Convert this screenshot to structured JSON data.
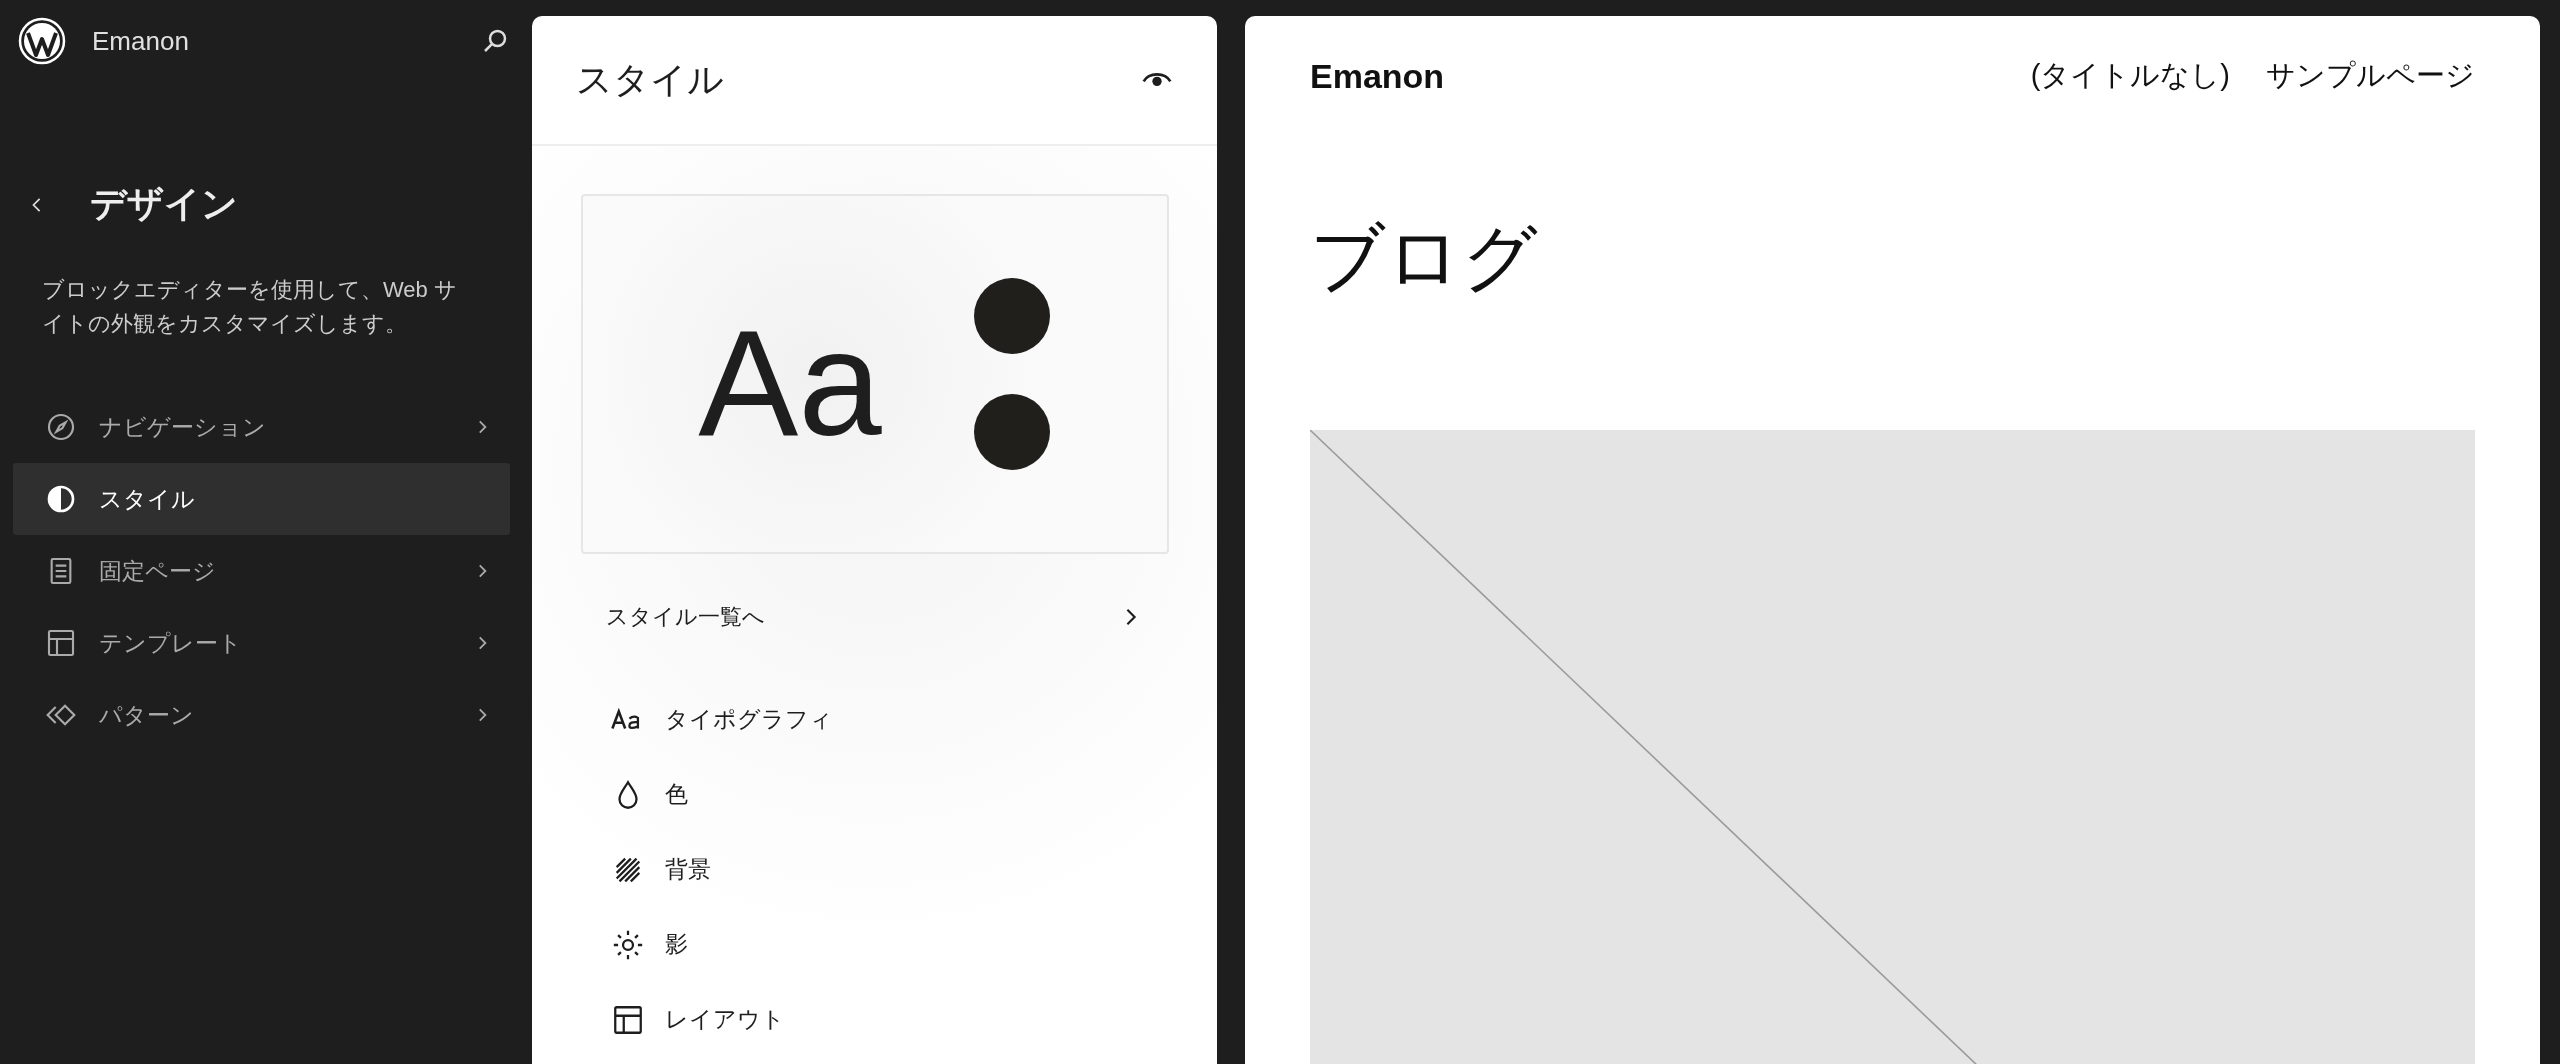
{
  "sidebar": {
    "site_title": "Emanon",
    "heading": "デザイン",
    "description": "ブロックエディターを使用して、Web サイトの外観をカスタマイズします。",
    "items": [
      {
        "label": "ナビゲーション",
        "kind": "navigation",
        "selected": false
      },
      {
        "label": "スタイル",
        "kind": "styles",
        "selected": true
      },
      {
        "label": "固定ページ",
        "kind": "pages",
        "selected": false
      },
      {
        "label": "テンプレート",
        "kind": "templates",
        "selected": false
      },
      {
        "label": "パターン",
        "kind": "patterns",
        "selected": false
      }
    ]
  },
  "styles_panel": {
    "title": "スタイル",
    "preview_sample": "Aa",
    "browse_link": "スタイル一覧へ",
    "items": [
      {
        "label": "タイポグラフィ",
        "kind": "typography"
      },
      {
        "label": "色",
        "kind": "color"
      },
      {
        "label": "背景",
        "kind": "background"
      },
      {
        "label": "影",
        "kind": "shadow"
      },
      {
        "label": "レイアウト",
        "kind": "layout"
      }
    ]
  },
  "preview": {
    "site_title": "Emanon",
    "nav": [
      "(タイトルなし)",
      "サンプルページ"
    ],
    "heading": "ブログ"
  }
}
